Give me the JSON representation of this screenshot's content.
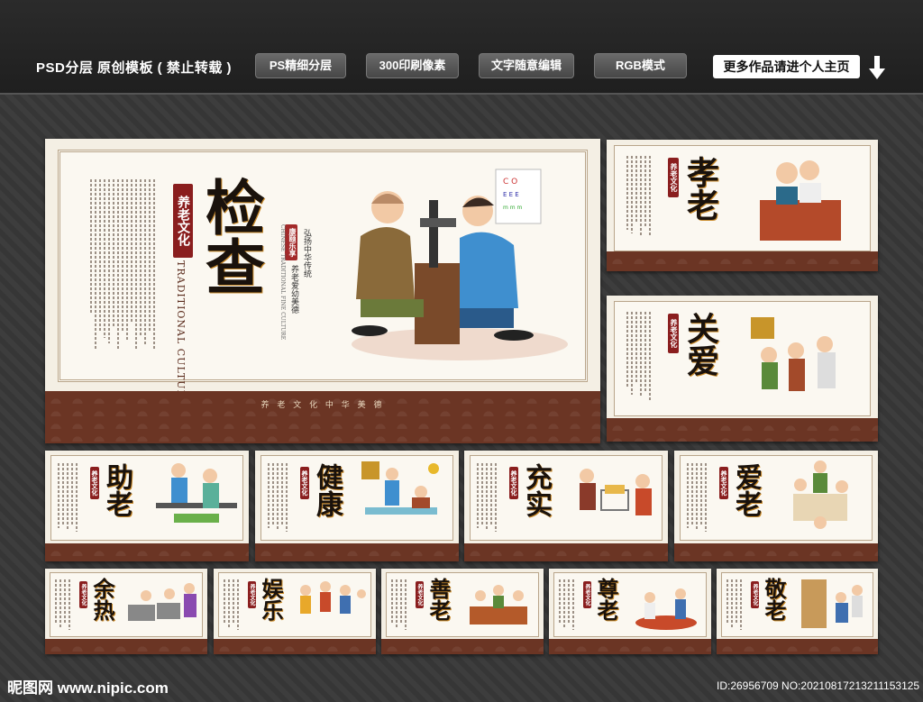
{
  "header": {
    "title": "PSD分层 原创模板 ( 禁止转载 )",
    "buttons": [
      {
        "label": "PS精细分层"
      },
      {
        "label": "300印刷像素"
      },
      {
        "label": "文字随意编辑"
      },
      {
        "label": "RGB模式"
      }
    ],
    "link_label": "更多作品请进个人主页"
  },
  "main_panel": {
    "title": "检查",
    "badge": "养老文化",
    "english": "TRADITIONAL CULTURE",
    "stamp": "康颐乐享",
    "slogan_1": "弘扬中华传统",
    "slogan_2": "养老爱幼美德",
    "slogan_en": "CHINESE TRADITIONAL FINE CULTURE",
    "footer": "养 老 文 化  中 华 美 德"
  },
  "panels": [
    {
      "title": "孝老",
      "badge": "养老文化"
    },
    {
      "title": "关爱",
      "badge": "养老文化"
    },
    {
      "title": "助老",
      "badge": "养老文化"
    },
    {
      "title": "健康",
      "badge": "养老文化"
    },
    {
      "title": "充实",
      "badge": "养老文化"
    },
    {
      "title": "爱老",
      "badge": "养老文化"
    },
    {
      "title": "余热",
      "badge": "养老文化"
    },
    {
      "title": "娱乐",
      "badge": "养老文化"
    },
    {
      "title": "善老",
      "badge": "养老文化"
    },
    {
      "title": "尊老",
      "badge": "养老文化"
    },
    {
      "title": "敬老",
      "badge": "养老文化"
    }
  ],
  "watermark": {
    "site": "昵图网 www.nipic.com",
    "id": "ID:26956709 NO:20210817213211153125"
  }
}
